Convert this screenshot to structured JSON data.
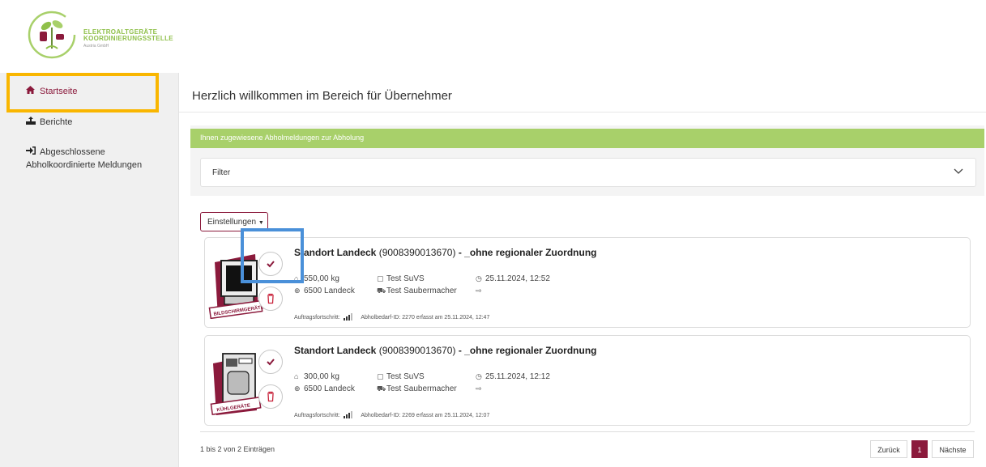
{
  "brand": {
    "line1": "ELEKTROALTGERÄTE",
    "line2": "KOORDINIERUNGSSTELLE",
    "line3": "Austria GmbH",
    "colors": {
      "green": "#a8d06a",
      "primary": "#8b1a3c",
      "highlight_yellow": "#f9b600",
      "highlight_blue": "#4a90d9"
    }
  },
  "sidebar": {
    "items": [
      {
        "icon": "home-icon",
        "label": "Startseite",
        "active": true
      },
      {
        "icon": "upload-icon",
        "label": "Berichte"
      },
      {
        "icon": "sign-in-icon",
        "label": "Abgeschlossene Abholkoordinierte Meldungen"
      }
    ]
  },
  "main": {
    "title": "Herzlich willkommen im Bereich für Übernehmer",
    "panel_title": "Ihnen zugewiesene Abholmeldungen zur Abholung",
    "filter_label": "Filter",
    "settings_label": "Einstellungen",
    "cards": [
      {
        "location": "Standort Landeck",
        "id": "(9008390013670)",
        "suffix": "- _ohne regionaler Zuordnung",
        "weight": "550,00 kg",
        "city": "6500 Landeck",
        "org": "Test SuVS",
        "transporter": "Test Saubermacher",
        "datetime": "25.11.2024, 12:52",
        "progress_label": "Auftragsfortschritt:",
        "footer": "Abholbedarf-ID: 2270 erfasst am 25.11.2024, 12:47",
        "badge": "BILDSCHIRMGERÄTE",
        "image": "monitor-icon"
      },
      {
        "location": "Standort Landeck",
        "id": "(9008390013670)",
        "suffix": "- _ohne regionaler Zuordnung",
        "weight": "300,00 kg",
        "city": "6500 Landeck",
        "org": "Test SuVS",
        "transporter": "Test Saubermacher",
        "datetime": "25.11.2024, 12:12",
        "progress_label": "Auftragsfortschritt:",
        "footer": "Abholbedarf-ID: 2269 erfasst am 25.11.2024, 12:07",
        "badge": "KÜHLGERÄTE",
        "image": "fridge-icon"
      }
    ],
    "entries_info": "1 bis 2 von 2 Einträgen",
    "pagination": {
      "prev": "Zurück",
      "current": "1",
      "next": "Nächste"
    }
  }
}
